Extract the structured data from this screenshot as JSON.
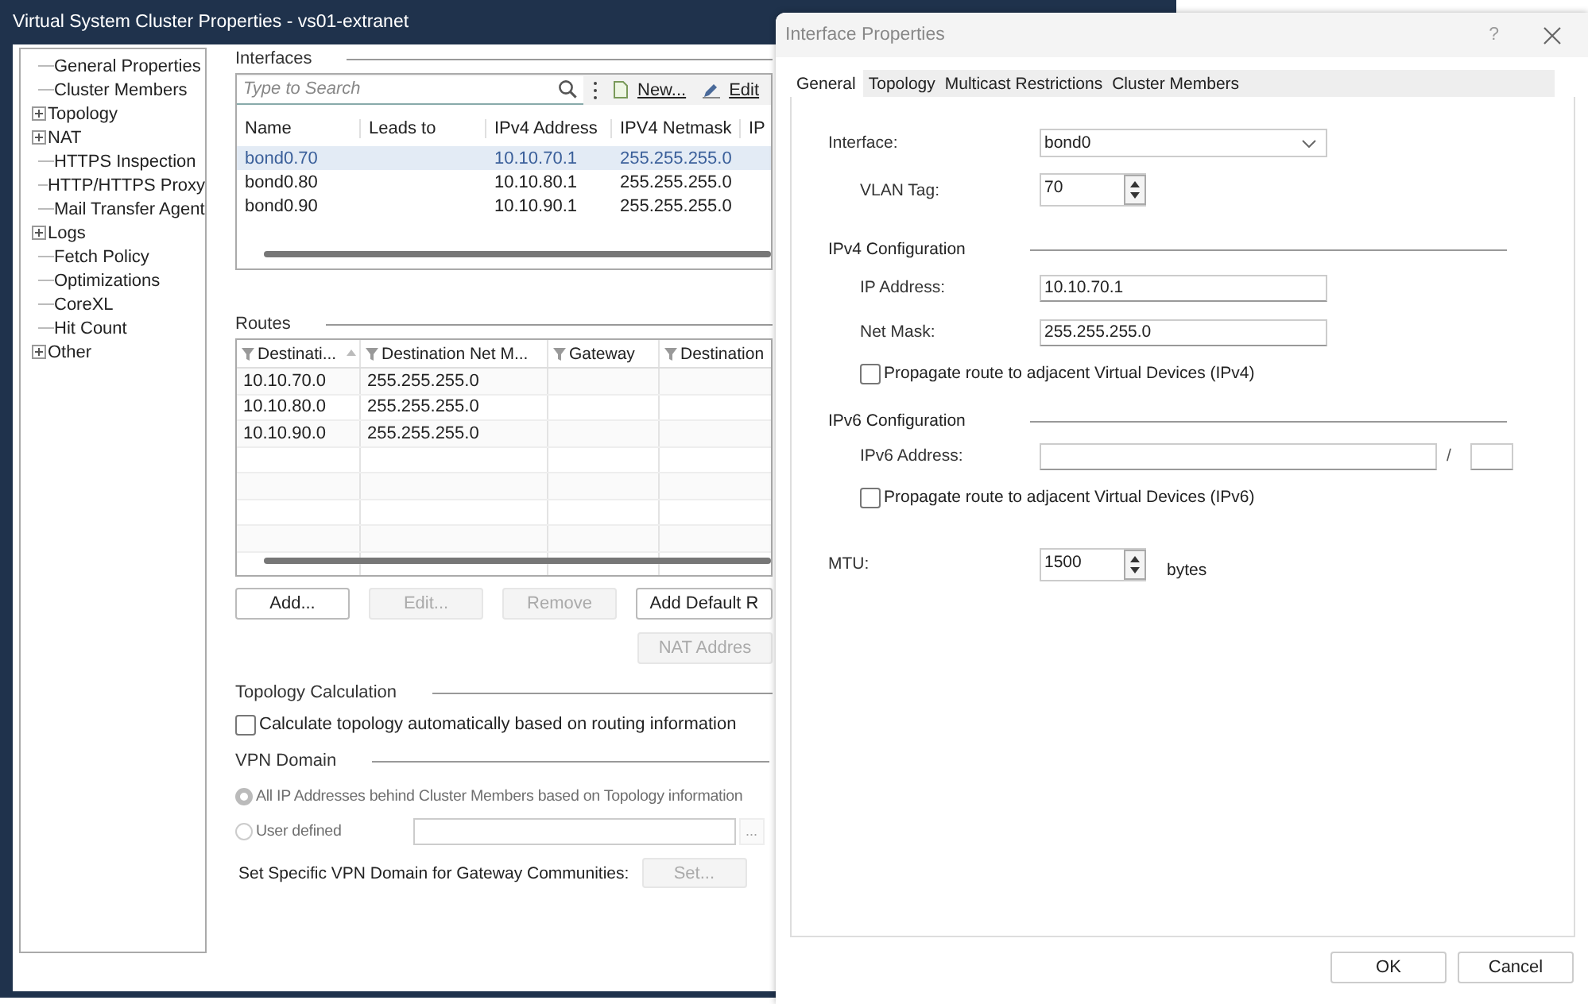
{
  "window": {
    "title": "Virtual System Cluster Properties - vs01-extranet"
  },
  "sidebar": {
    "items": [
      {
        "label": "General Properties",
        "kind": "leaf"
      },
      {
        "label": "Cluster Members",
        "kind": "leaf"
      },
      {
        "label": "Topology",
        "kind": "branch"
      },
      {
        "label": "NAT",
        "kind": "branch"
      },
      {
        "label": "HTTPS Inspection",
        "kind": "leaf"
      },
      {
        "label": "HTTP/HTTPS Proxy",
        "kind": "leaf"
      },
      {
        "label": "Mail Transfer Agent",
        "kind": "leaf"
      },
      {
        "label": "Logs",
        "kind": "branch"
      },
      {
        "label": "Fetch Policy",
        "kind": "leaf"
      },
      {
        "label": "Optimizations",
        "kind": "leaf"
      },
      {
        "label": "CoreXL",
        "kind": "leaf"
      },
      {
        "label": "Hit Count",
        "kind": "leaf"
      },
      {
        "label": "Other",
        "kind": "branch"
      }
    ]
  },
  "interfaces": {
    "title": "Interfaces",
    "search": {
      "placeholder": "Type to Search"
    },
    "toolbar": [
      {
        "label": "New...",
        "kind": "new"
      },
      {
        "label": "Edit",
        "kind": "edit"
      }
    ],
    "columns": [
      "Name",
      "Leads to",
      "IPv4 Address",
      "IPV4 Netmask",
      "IP"
    ],
    "rows": [
      {
        "name": "bond0.70",
        "ipv4_address": "10.10.70.1",
        "ipv4_netmask": "255.255.255.0",
        "selected": true
      },
      {
        "name": "bond0.80",
        "ipv4_address": "10.10.80.1",
        "ipv4_netmask": "255.255.255.0",
        "selected": false
      },
      {
        "name": "bond0.90",
        "ipv4_address": "10.10.90.1",
        "ipv4_netmask": "255.255.255.0",
        "selected": false
      }
    ]
  },
  "routes": {
    "title": "Routes",
    "columns": [
      {
        "label": "Destinati...",
        "sorted": true
      },
      {
        "label": "Destination Net M...",
        "sorted": false
      },
      {
        "label": "Gateway",
        "sorted": false
      },
      {
        "label": "Destination",
        "sorted": false
      }
    ],
    "rows": [
      {
        "destination": "10.10.70.0",
        "netmask": "255.255.255.0"
      },
      {
        "destination": "10.10.80.0",
        "netmask": "255.255.255.0"
      },
      {
        "destination": "10.10.90.0",
        "netmask": "255.255.255.0"
      }
    ],
    "buttons": [
      {
        "label": "Add...",
        "disabled": false
      },
      {
        "label": "Edit...",
        "disabled": true
      },
      {
        "label": "Remove",
        "disabled": true
      },
      {
        "label": "Add Default R",
        "disabled": false
      }
    ],
    "nat_button": {
      "label": "NAT Addres",
      "disabled": true
    }
  },
  "topology_calculation": {
    "title": "Topology Calculation",
    "checkbox": {
      "label": "Calculate topology automatically based on routing information",
      "checked": false
    }
  },
  "vpn_domain": {
    "title": "VPN Domain",
    "options": [
      {
        "label": "All IP Addresses behind Cluster Members based on Topology information",
        "selected": true
      },
      {
        "label": "User defined",
        "selected": false
      }
    ],
    "browse_button": "...",
    "communities_label": "Set Specific VPN Domain for Gateway Communities:",
    "set_button": {
      "label": "Set...",
      "disabled": true
    }
  },
  "dialog": {
    "title": "Interface Properties",
    "help": "?",
    "tabs": [
      {
        "label": "General",
        "selected": true
      },
      {
        "label": "Topology",
        "selected": false
      },
      {
        "label": "Multicast Restrictions",
        "selected": false
      },
      {
        "label": "Cluster Members",
        "selected": false
      }
    ],
    "interface": {
      "label": "Interface:",
      "value": "bond0"
    },
    "vlan_tag": {
      "label": "VLAN Tag:",
      "value": "70"
    },
    "ipv4": {
      "title": "IPv4 Configuration",
      "ip_label": "IP Address:",
      "ip_value": "10.10.70.1",
      "mask_label": "Net Mask:",
      "mask_value": "255.255.255.0",
      "propagate": {
        "label": "Propagate route to adjacent Virtual Devices (IPv4)",
        "checked": false
      }
    },
    "ipv6": {
      "title": "IPv6 Configuration",
      "address_label": "IPv6 Address:",
      "separator": "/",
      "propagate": {
        "label": "Propagate route to adjacent Virtual Devices (IPv6)",
        "checked": false
      }
    },
    "mtu": {
      "label": "MTU:",
      "value": "1500",
      "unit": "bytes"
    },
    "buttons": [
      "OK",
      "Cancel"
    ]
  }
}
